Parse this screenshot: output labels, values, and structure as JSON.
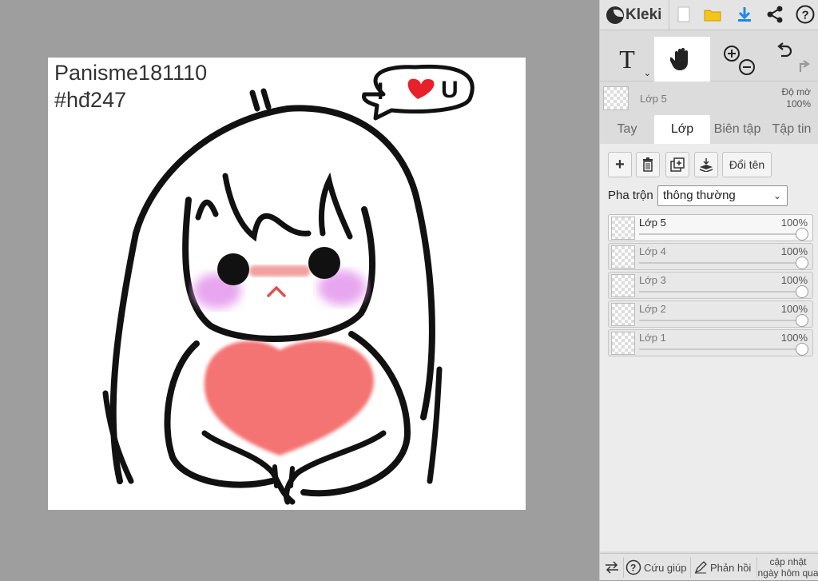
{
  "app": {
    "name": "Kleki"
  },
  "canvas_text": {
    "line1": "Panisme181110",
    "line2": "#hđ247"
  },
  "speech_bubble": {
    "left": "I",
    "right": "U"
  },
  "toolbar": {
    "icons": [
      "new-file-icon",
      "open-folder-icon",
      "download-icon",
      "share-icon",
      "help-icon"
    ],
    "help_label": "?"
  },
  "tools": {
    "text_label": "T",
    "active": "hand"
  },
  "current_layer": {
    "name": "Lớp 5",
    "opacity_label": "Độ mờ",
    "opacity_value": "100%"
  },
  "tabs": [
    "Tay",
    "Lớp",
    "Biên tập",
    "Tập tin"
  ],
  "active_tab": "Lớp",
  "layer_buttons": {
    "rename": "Đổi tên"
  },
  "blend": {
    "label": "Pha trộn",
    "value": "thông thường"
  },
  "layers": [
    {
      "name": "Lớp 5",
      "opacity": "100%",
      "active": true
    },
    {
      "name": "Lớp 4",
      "opacity": "100%"
    },
    {
      "name": "Lớp 3",
      "opacity": "100%"
    },
    {
      "name": "Lớp 2",
      "opacity": "100%"
    },
    {
      "name": "Lớp 1",
      "opacity": "100%"
    }
  ],
  "footer": {
    "help": "Cứu giúp",
    "feedback": "Phản hồi",
    "update_line1": "cập nhật",
    "update_line2": "ngày hôm qua"
  },
  "colors": {
    "heart": "#f47373",
    "blush": "#e7a6ef",
    "nose_bar": "#f2a0a0",
    "accent_blue": "#1e88e5",
    "folder": "#f5c518"
  }
}
